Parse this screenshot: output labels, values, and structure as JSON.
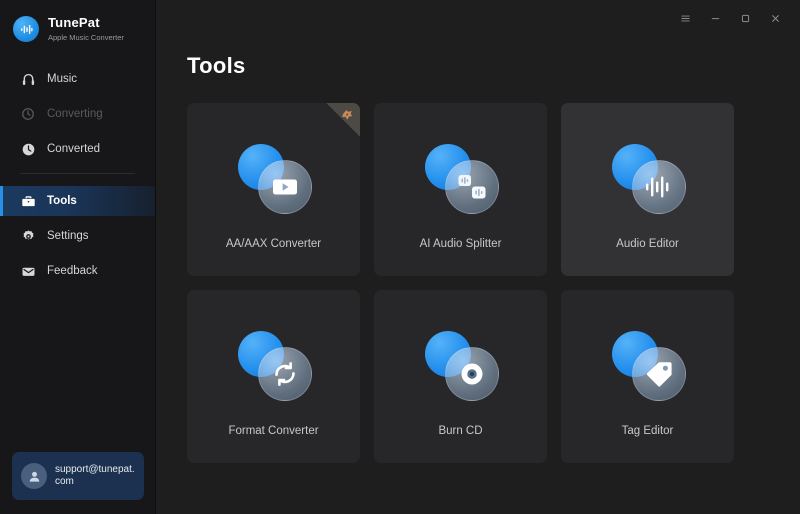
{
  "brand": {
    "name": "TunePat",
    "tagline": "Apple Music Converter",
    "logo_icon": "audio-waveform-icon"
  },
  "sidebar": {
    "items": [
      {
        "label": "Music",
        "icon": "headphones-icon",
        "state": "normal"
      },
      {
        "label": "Converting",
        "icon": "converting-icon",
        "state": "disabled"
      },
      {
        "label": "Converted",
        "icon": "clock-icon",
        "state": "normal"
      },
      {
        "label": "Tools",
        "icon": "toolbox-icon",
        "state": "active"
      },
      {
        "label": "Settings",
        "icon": "gear-icon",
        "state": "normal"
      },
      {
        "label": "Feedback",
        "icon": "envelope-icon",
        "state": "normal"
      }
    ],
    "account": {
      "email": "support@tunepat.com",
      "avatar_icon": "person-icon"
    }
  },
  "titlebar": {
    "menu_label": "menu-icon",
    "minimize_label": "minimize-icon",
    "maximize_label": "maximize-icon",
    "close_label": "close-icon"
  },
  "main": {
    "page_title": "Tools",
    "cards": [
      {
        "label": "AA/AAX Converter",
        "icon": "play-button-icon",
        "ribbon": true,
        "hovered": false
      },
      {
        "label": "AI Audio Splitter",
        "icon": "audio-split-icon",
        "ribbon": false,
        "hovered": false
      },
      {
        "label": "Audio Editor",
        "icon": "audio-waveform-icon",
        "ribbon": false,
        "hovered": true
      },
      {
        "label": "Format Converter",
        "icon": "refresh-arrows-icon",
        "ribbon": false,
        "hovered": false
      },
      {
        "label": "Burn CD",
        "icon": "compact-disc-icon",
        "ribbon": false,
        "hovered": false
      },
      {
        "label": "Tag Editor",
        "icon": "price-tag-icon",
        "ribbon": false,
        "hovered": false
      }
    ]
  },
  "colors": {
    "accent_blue": "#2b8fe8",
    "sidebar_bg": "#17171a",
    "content_bg": "#1e1e1e",
    "card_bg": "#272729",
    "card_hover_bg": "#323235",
    "account_bg": "#1c3150",
    "ribbon": "#c98a5a"
  }
}
